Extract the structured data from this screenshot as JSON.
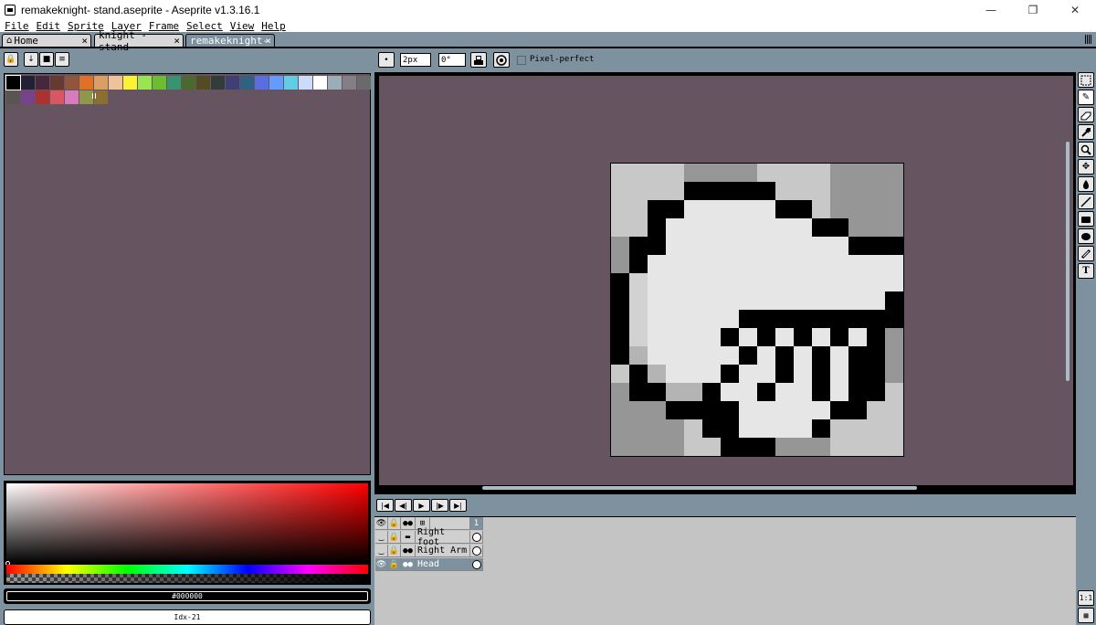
{
  "window": {
    "title": "remakeknight- stand.aseprite - Aseprite v1.3.16.1",
    "minimize": "—",
    "maximize": "❐",
    "close": "✕"
  },
  "menu": [
    "File",
    "Edit",
    "Sprite",
    "Layer",
    "Frame",
    "Select",
    "View",
    "Help"
  ],
  "tabs": [
    {
      "label": "Home",
      "icon": "home-icon",
      "close": "×"
    },
    {
      "label": "knight - stand",
      "close": "×"
    },
    {
      "label": "remakeknight-",
      "close": "×",
      "active": true
    }
  ],
  "palette": {
    "buttons": [
      "lock-icon",
      "sort-icon",
      "options-icon",
      "menu-icon"
    ],
    "colors": [
      "#000000",
      "#222034",
      "#45283c",
      "#663931",
      "#8f563b",
      "#df7126",
      "#d9a066",
      "#eec39a",
      "#fbf236",
      "#99e550",
      "#6abe30",
      "#37946e",
      "#4b692f",
      "#524b24",
      "#323c39",
      "#3f3f74",
      "#306082",
      "#5b6ee1",
      "#639bff",
      "#5fcde4",
      "#cbdbfc",
      "#ffffff",
      "#9badb7",
      "#847e87",
      "#696a6a",
      "#595652",
      "#76428a",
      "#ac3232",
      "#d95763",
      "#d77bba",
      "#8f974a",
      "#8a6f30"
    ]
  },
  "color_picker": {
    "hex": "#000000",
    "index": "Idx-21"
  },
  "context_bar": {
    "brush_size": "2px",
    "brush_angle": "0°",
    "pixel_perfect": "Pixel-perfect"
  },
  "tools": [
    "rectangular-marquee-icon",
    "pencil-icon",
    "eraser-icon",
    "eyedropper-icon",
    "zoom-icon",
    "move-icon",
    "paint-bucket-icon",
    "line-icon",
    "rectangle-icon",
    "filled-ellipse-icon",
    "blur-icon",
    "text-icon"
  ],
  "timeline": {
    "controls": [
      "first-frame-icon",
      "previous-frame-icon",
      "play-icon",
      "next-frame-icon",
      "last-frame-icon"
    ],
    "frame_header": "1",
    "layers": [
      {
        "name": "Right foot",
        "visible": false
      },
      {
        "name": "Right Arm",
        "visible": false
      },
      {
        "name": "Head",
        "visible": true,
        "selected": true
      }
    ],
    "bottom_buttons": [
      "1:1",
      "filmstrip-icon"
    ]
  }
}
